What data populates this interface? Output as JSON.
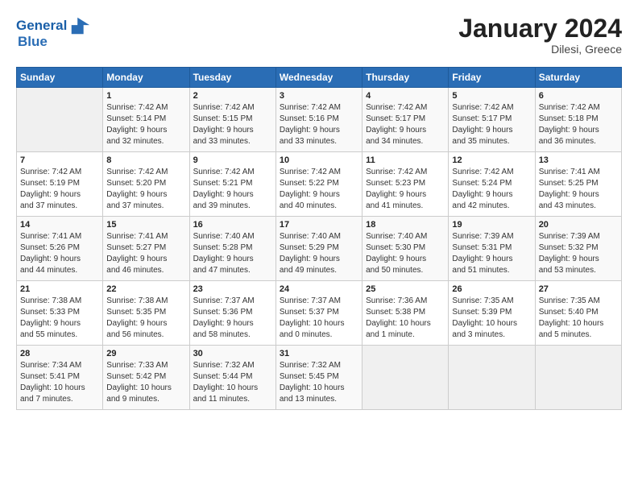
{
  "header": {
    "logo_line1": "General",
    "logo_line2": "Blue",
    "title": "January 2024",
    "subtitle": "Dilesi, Greece"
  },
  "days_of_week": [
    "Sunday",
    "Monday",
    "Tuesday",
    "Wednesday",
    "Thursday",
    "Friday",
    "Saturday"
  ],
  "weeks": [
    [
      {
        "day": "",
        "content": ""
      },
      {
        "day": "1",
        "content": "Sunrise: 7:42 AM\nSunset: 5:14 PM\nDaylight: 9 hours\nand 32 minutes."
      },
      {
        "day": "2",
        "content": "Sunrise: 7:42 AM\nSunset: 5:15 PM\nDaylight: 9 hours\nand 33 minutes."
      },
      {
        "day": "3",
        "content": "Sunrise: 7:42 AM\nSunset: 5:16 PM\nDaylight: 9 hours\nand 33 minutes."
      },
      {
        "day": "4",
        "content": "Sunrise: 7:42 AM\nSunset: 5:17 PM\nDaylight: 9 hours\nand 34 minutes."
      },
      {
        "day": "5",
        "content": "Sunrise: 7:42 AM\nSunset: 5:17 PM\nDaylight: 9 hours\nand 35 minutes."
      },
      {
        "day": "6",
        "content": "Sunrise: 7:42 AM\nSunset: 5:18 PM\nDaylight: 9 hours\nand 36 minutes."
      }
    ],
    [
      {
        "day": "7",
        "content": "Sunrise: 7:42 AM\nSunset: 5:19 PM\nDaylight: 9 hours\nand 37 minutes."
      },
      {
        "day": "8",
        "content": "Sunrise: 7:42 AM\nSunset: 5:20 PM\nDaylight: 9 hours\nand 37 minutes."
      },
      {
        "day": "9",
        "content": "Sunrise: 7:42 AM\nSunset: 5:21 PM\nDaylight: 9 hours\nand 39 minutes."
      },
      {
        "day": "10",
        "content": "Sunrise: 7:42 AM\nSunset: 5:22 PM\nDaylight: 9 hours\nand 40 minutes."
      },
      {
        "day": "11",
        "content": "Sunrise: 7:42 AM\nSunset: 5:23 PM\nDaylight: 9 hours\nand 41 minutes."
      },
      {
        "day": "12",
        "content": "Sunrise: 7:42 AM\nSunset: 5:24 PM\nDaylight: 9 hours\nand 42 minutes."
      },
      {
        "day": "13",
        "content": "Sunrise: 7:41 AM\nSunset: 5:25 PM\nDaylight: 9 hours\nand 43 minutes."
      }
    ],
    [
      {
        "day": "14",
        "content": "Sunrise: 7:41 AM\nSunset: 5:26 PM\nDaylight: 9 hours\nand 44 minutes."
      },
      {
        "day": "15",
        "content": "Sunrise: 7:41 AM\nSunset: 5:27 PM\nDaylight: 9 hours\nand 46 minutes."
      },
      {
        "day": "16",
        "content": "Sunrise: 7:40 AM\nSunset: 5:28 PM\nDaylight: 9 hours\nand 47 minutes."
      },
      {
        "day": "17",
        "content": "Sunrise: 7:40 AM\nSunset: 5:29 PM\nDaylight: 9 hours\nand 49 minutes."
      },
      {
        "day": "18",
        "content": "Sunrise: 7:40 AM\nSunset: 5:30 PM\nDaylight: 9 hours\nand 50 minutes."
      },
      {
        "day": "19",
        "content": "Sunrise: 7:39 AM\nSunset: 5:31 PM\nDaylight: 9 hours\nand 51 minutes."
      },
      {
        "day": "20",
        "content": "Sunrise: 7:39 AM\nSunset: 5:32 PM\nDaylight: 9 hours\nand 53 minutes."
      }
    ],
    [
      {
        "day": "21",
        "content": "Sunrise: 7:38 AM\nSunset: 5:33 PM\nDaylight: 9 hours\nand 55 minutes."
      },
      {
        "day": "22",
        "content": "Sunrise: 7:38 AM\nSunset: 5:35 PM\nDaylight: 9 hours\nand 56 minutes."
      },
      {
        "day": "23",
        "content": "Sunrise: 7:37 AM\nSunset: 5:36 PM\nDaylight: 9 hours\nand 58 minutes."
      },
      {
        "day": "24",
        "content": "Sunrise: 7:37 AM\nSunset: 5:37 PM\nDaylight: 10 hours\nand 0 minutes."
      },
      {
        "day": "25",
        "content": "Sunrise: 7:36 AM\nSunset: 5:38 PM\nDaylight: 10 hours\nand 1 minute."
      },
      {
        "day": "26",
        "content": "Sunrise: 7:35 AM\nSunset: 5:39 PM\nDaylight: 10 hours\nand 3 minutes."
      },
      {
        "day": "27",
        "content": "Sunrise: 7:35 AM\nSunset: 5:40 PM\nDaylight: 10 hours\nand 5 minutes."
      }
    ],
    [
      {
        "day": "28",
        "content": "Sunrise: 7:34 AM\nSunset: 5:41 PM\nDaylight: 10 hours\nand 7 minutes."
      },
      {
        "day": "29",
        "content": "Sunrise: 7:33 AM\nSunset: 5:42 PM\nDaylight: 10 hours\nand 9 minutes."
      },
      {
        "day": "30",
        "content": "Sunrise: 7:32 AM\nSunset: 5:44 PM\nDaylight: 10 hours\nand 11 minutes."
      },
      {
        "day": "31",
        "content": "Sunrise: 7:32 AM\nSunset: 5:45 PM\nDaylight: 10 hours\nand 13 minutes."
      },
      {
        "day": "",
        "content": ""
      },
      {
        "day": "",
        "content": ""
      },
      {
        "day": "",
        "content": ""
      }
    ]
  ]
}
